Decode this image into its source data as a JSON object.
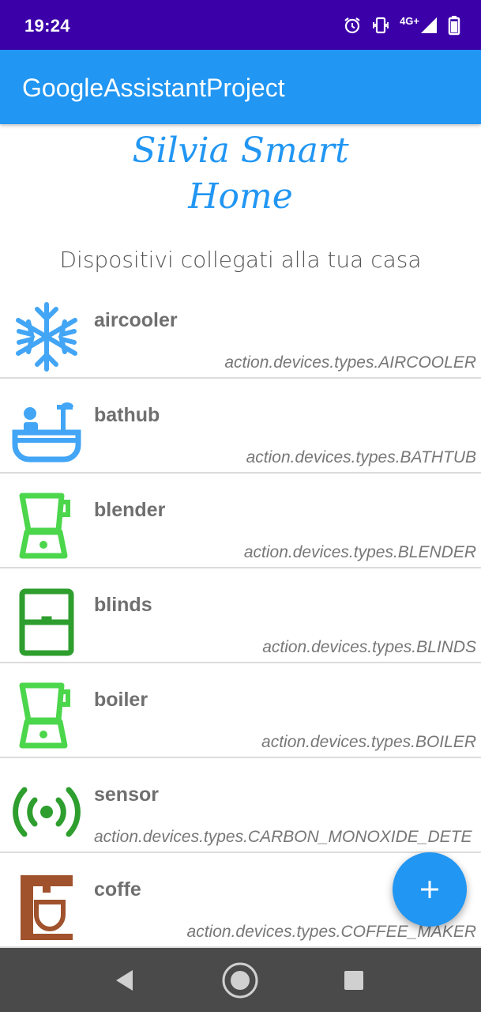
{
  "status_bar": {
    "time": "19:24",
    "network": "4G+",
    "icons": [
      "alarm-icon",
      "vibrate-icon",
      "signal-icon",
      "battery-icon"
    ]
  },
  "app_bar": {
    "title": "GoogleAssistantProject"
  },
  "brand": {
    "line1": "Silvia Smart",
    "line2": "Home"
  },
  "subtitle": "Dispositivi collegati alla tua casa",
  "devices": [
    {
      "name": "aircooler",
      "type": "action.devices.types.AIRCOOLER",
      "icon": "snowflake-icon",
      "color": "#42a5f5"
    },
    {
      "name": "bathub",
      "type": "action.devices.types.BATHTUB",
      "icon": "bathtub-icon",
      "color": "#42a5f5"
    },
    {
      "name": "blender",
      "type": "action.devices.types.BLENDER",
      "icon": "blender-icon",
      "color": "#4cd64c"
    },
    {
      "name": "blinds",
      "type": "action.devices.types.BLINDS",
      "icon": "blinds-icon",
      "color": "#2e9e2e"
    },
    {
      "name": "boiler",
      "type": "action.devices.types.BOILER",
      "icon": "blender-icon",
      "color": "#4cd64c"
    },
    {
      "name": "sensor",
      "type": "action.devices.types.CARBON_MONOXIDE_DETE",
      "icon": "sensor-icon",
      "color": "#2e9e2e"
    },
    {
      "name": "coffe",
      "type": "action.devices.types.COFFEE_MAKER",
      "icon": "coffee-maker-icon",
      "color": "#a0522d"
    }
  ],
  "fab": {
    "label": "+",
    "color": "#2196f3"
  },
  "nav_bar": {
    "buttons": [
      "back-icon",
      "home-icon",
      "recents-icon"
    ]
  },
  "colors": {
    "status_bar": "#3c00a8",
    "app_bar": "#2196f3",
    "nav_bar": "#4a4a4a"
  }
}
